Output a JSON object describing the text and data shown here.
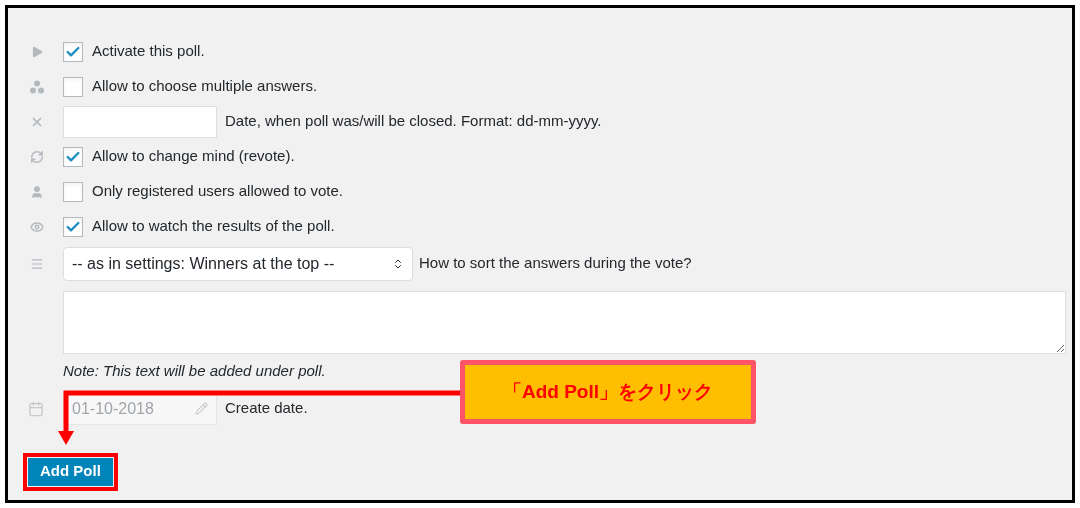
{
  "options": [
    {
      "kind": "checkbox",
      "label": "Activate this poll.",
      "checked": true
    },
    {
      "kind": "checkbox",
      "label": "Allow to choose multiple answers.",
      "checked": false
    },
    {
      "kind": "date",
      "label": "Date, when poll was/will be closed. Format: dd-mm-yyyy."
    },
    {
      "kind": "checkbox",
      "label": "Allow to change mind (revote).",
      "checked": true
    },
    {
      "kind": "checkbox",
      "label": "Only registered users allowed to vote.",
      "checked": false
    },
    {
      "kind": "checkbox",
      "label": "Allow to watch the results of the poll.",
      "checked": true
    }
  ],
  "sort_order": {
    "value": "-- as in settings: Winners at the top --",
    "hint": "How to sort the answers during the vote?"
  },
  "note": "Note: This text will be added under poll.",
  "create_date": {
    "value": "01-10-2018",
    "label": "Create date."
  },
  "submit": "Add Poll",
  "callout": "「Add Poll」をクリック"
}
